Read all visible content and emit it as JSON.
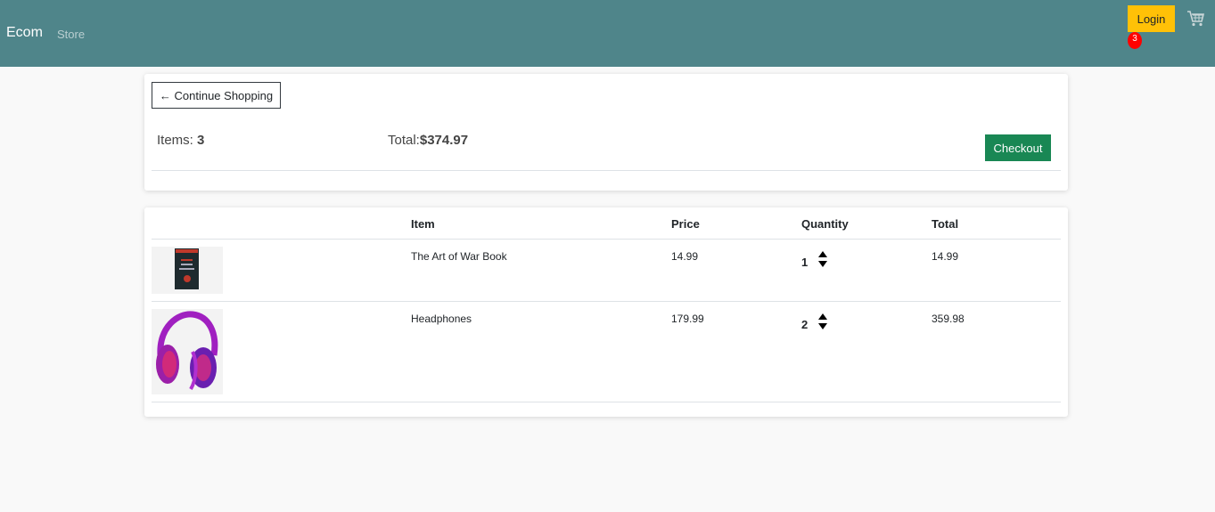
{
  "navbar": {
    "brand": "Ecom",
    "links": [
      "Store"
    ],
    "login_label": "Login",
    "cart_count": "3",
    "bg_color": "#4f858a",
    "cart_icon": "shopping-cart-icon"
  },
  "summary": {
    "continue_label": "← Continue Shopping",
    "items_label": "Items: ",
    "items_value": "3",
    "total_label": "Total:",
    "total_value": "$374.97",
    "checkout_label": "Checkout"
  },
  "cart": {
    "headers": [
      "",
      "Item",
      "Price",
      "Quantity",
      "Total"
    ],
    "rows": [
      {
        "image": "book-cover-image",
        "item": "The Art of War Book",
        "price": "14.99",
        "quantity": "1",
        "total": "14.99"
      },
      {
        "image": "headphones-image",
        "item": "Headphones",
        "price": "179.99",
        "quantity": "2",
        "total": "359.98"
      }
    ]
  },
  "colors": {
    "login": "#ffc107",
    "checkout": "#198754",
    "badge": "#ff0000"
  }
}
